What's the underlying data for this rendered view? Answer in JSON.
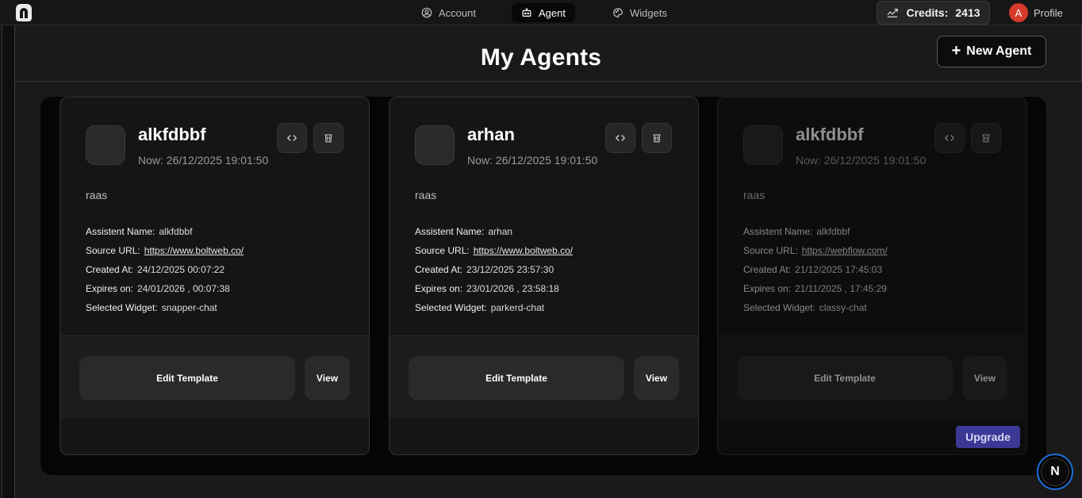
{
  "nav": {
    "tabs": [
      {
        "label": "Account",
        "icon": "user-circle-icon"
      },
      {
        "label": "Agent",
        "icon": "robot-icon",
        "active": true
      },
      {
        "label": "Widgets",
        "icon": "palette-icon"
      }
    ],
    "credits_label": "Credits:",
    "credits_value": "2413",
    "profile_initial": "A",
    "profile_label": "Profile"
  },
  "page": {
    "title": "My Agents",
    "new_agent_label": "New Agent"
  },
  "field_labels": {
    "assistant_name": "Assistent Name:",
    "source_url": "Source URL:",
    "created_at": "Created At:",
    "expires_on": "Expires on:",
    "selected_widget": "Selected Widget:"
  },
  "agents": [
    {
      "name": "alkfdbbf",
      "time": "Now: 26/12/2025 19:01:50",
      "description": "raas",
      "assistant_name": "alkfdbbf",
      "source_url": "https://www.boltweb.co/",
      "created_at": "24/12/2025 00:07:22",
      "expires_on": "24/01/2026 , 00:07:38",
      "selected_widget": "snapper-chat",
      "edit_label": "Edit Template",
      "view_label": "View"
    },
    {
      "name": "arhan",
      "time": "Now: 26/12/2025 19:01:50",
      "description": "raas",
      "assistant_name": "arhan",
      "source_url": "https://www.boltweb.co/",
      "created_at": "23/12/2025 23:57:30",
      "expires_on": "23/01/2026 , 23:58:18",
      "selected_widget": "parkerd-chat",
      "edit_label": "Edit Template",
      "view_label": "View"
    },
    {
      "name": "alkfdbbf",
      "time": "Now: 26/12/2025 19:01:50",
      "description": "raas",
      "assistant_name": "alkfdbbf",
      "source_url": "https://webflow.com/",
      "created_at": "21/12/2025 17:45:03",
      "expires_on": "21/11/2025 , 17:45:29",
      "selected_widget": "classy-chat",
      "edit_label": "Edit Template",
      "view_label": "View",
      "expired": true
    }
  ],
  "upgrade_label": "Upgrade",
  "dev_badge_label": "N",
  "colors": {
    "background": "#141414",
    "card": "#151515",
    "upgrade": "#3b3896",
    "avatar": "#d63a2a",
    "dev_badge_ring": "#1f6fd8"
  }
}
